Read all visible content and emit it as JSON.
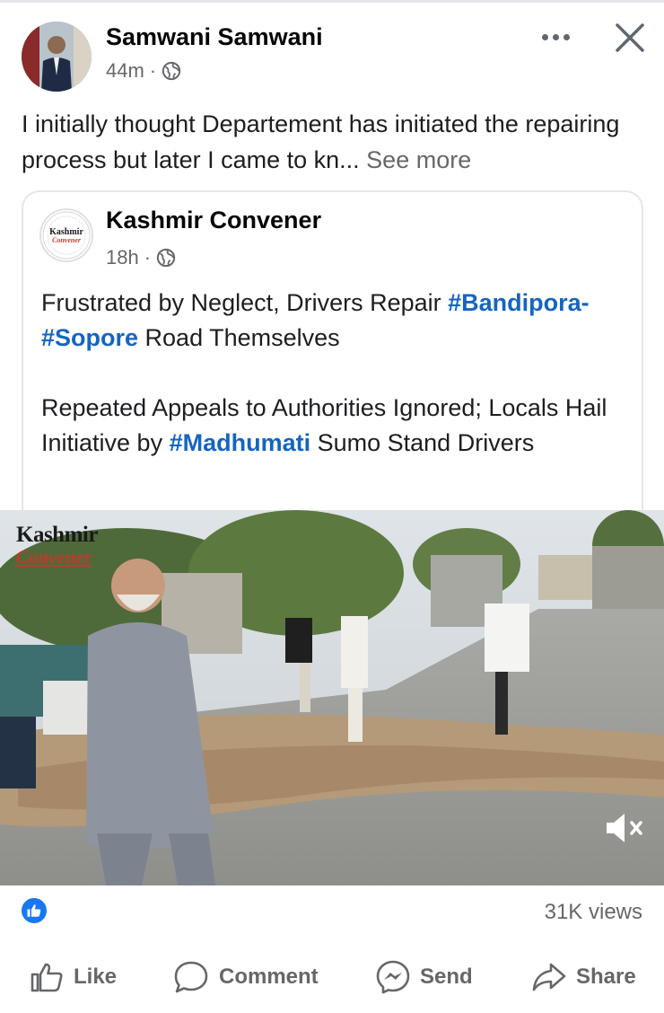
{
  "post": {
    "author": "Samwani Samwani",
    "time": "44m",
    "separator": "·",
    "text": "I initially thought Departement has initiated the repairing process but later I came to kn... ",
    "see_more": "See more"
  },
  "shared": {
    "page_name": "Kashmir Convener",
    "time": "18h",
    "separator": "·",
    "logo_text_line1": "Kashmir",
    "logo_text_line2": "Convener",
    "headline_part1": "Frustrated by Neglect, Drivers Repair ",
    "headline_hashtag": "#Bandipora-#Sopore",
    "headline_part2": " Road Themselves",
    "body_part1": "Repeated Appeals to Authorities Ignored; Locals Hail Initiative by ",
    "body_hashtag": "#Madhumati",
    "body_part2": " Sumo Stand Drivers"
  },
  "video": {
    "watermark_line1": "Kashmir",
    "watermark_line2": "Convener"
  },
  "stats": {
    "views": "31K views"
  },
  "actions": {
    "like": "Like",
    "comment": "Comment",
    "send": "Send",
    "share": "Share"
  },
  "colors": {
    "accent": "#1877f2",
    "hashtag": "#1565c0",
    "secondary_text": "#65676b",
    "watermark_red": "#c0392b"
  },
  "icons": {
    "more": "more-horizontal-icon",
    "close": "close-icon",
    "privacy": "globe-icon",
    "mute": "speaker-muted-icon",
    "like": "thumbs-up-icon",
    "comment": "speech-bubble-icon",
    "send": "messenger-icon",
    "share": "share-arrow-icon"
  }
}
